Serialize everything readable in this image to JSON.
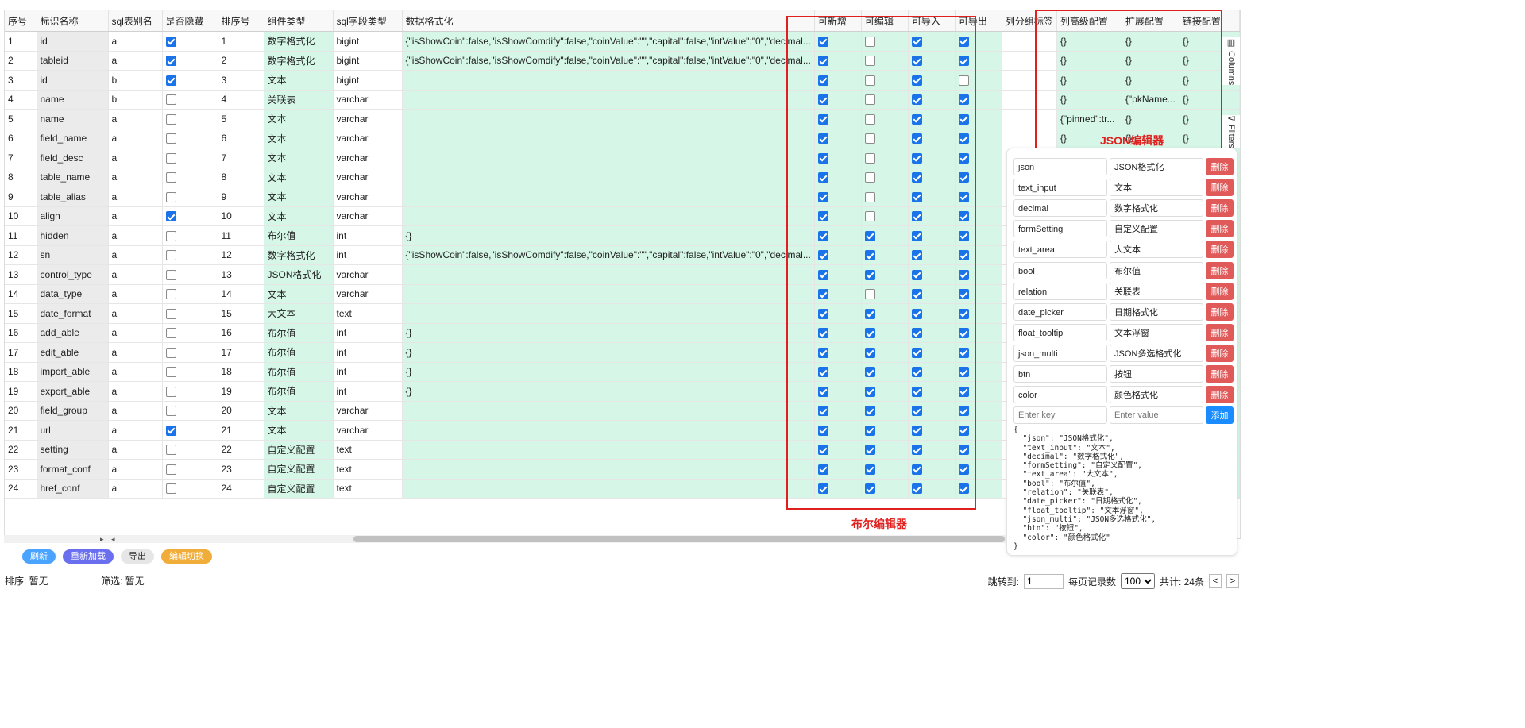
{
  "columns": [
    "序号",
    "标识名称",
    "sql表别名",
    "是否隐藏",
    "排序号",
    "组件类型",
    "sql字段类型",
    "数据格式化",
    "可新增",
    "可编辑",
    "可导入",
    "可导出",
    "列分组标签",
    "列高级配置",
    "扩展配置",
    "链接配置"
  ],
  "rows": [
    {
      "n": "1",
      "name": "id",
      "alias": "a",
      "hidden": true,
      "sort": "1",
      "ctype": "数字格式化",
      "sqltype": "bigint",
      "fmt": "{\"isShowCoin\":false,\"isShowComdify\":false,\"coinValue\":\"\",\"capital\":false,\"intValue\":\"0\",\"decimal...",
      "add": true,
      "edit": false,
      "imp": true,
      "exp": true,
      "adv": "{}",
      "ext": "{}",
      "link": "{}"
    },
    {
      "n": "2",
      "name": "tableid",
      "alias": "a",
      "hidden": true,
      "sort": "2",
      "ctype": "数字格式化",
      "sqltype": "bigint",
      "fmt": "{\"isShowCoin\":false,\"isShowComdify\":false,\"coinValue\":\"\",\"capital\":false,\"intValue\":\"0\",\"decimal...",
      "add": true,
      "edit": false,
      "imp": true,
      "exp": true,
      "adv": "{}",
      "ext": "{}",
      "link": "{}"
    },
    {
      "n": "3",
      "name": "id",
      "alias": "b",
      "hidden": true,
      "sort": "3",
      "ctype": "文本",
      "sqltype": "bigint",
      "fmt": "",
      "add": true,
      "edit": false,
      "imp": true,
      "exp": false,
      "adv": "{}",
      "ext": "{}",
      "link": "{}"
    },
    {
      "n": "4",
      "name": "name",
      "alias": "b",
      "hidden": false,
      "sort": "4",
      "ctype": "关联表",
      "sqltype": "varchar",
      "fmt": "",
      "add": true,
      "edit": false,
      "imp": true,
      "exp": true,
      "adv": "{}",
      "ext": "{\"pkName...",
      "link": "{}"
    },
    {
      "n": "5",
      "name": "name",
      "alias": "a",
      "hidden": false,
      "sort": "5",
      "ctype": "文本",
      "sqltype": "varchar",
      "fmt": "",
      "add": true,
      "edit": false,
      "imp": true,
      "exp": true,
      "adv": "{\"pinned\":tr...",
      "ext": "{}",
      "link": "{}"
    },
    {
      "n": "6",
      "name": "field_name",
      "alias": "a",
      "hidden": false,
      "sort": "6",
      "ctype": "文本",
      "sqltype": "varchar",
      "fmt": "",
      "add": true,
      "edit": false,
      "imp": true,
      "exp": true,
      "adv": "{}",
      "ext": "{}",
      "link": "{}"
    },
    {
      "n": "7",
      "name": "field_desc",
      "alias": "a",
      "hidden": false,
      "sort": "7",
      "ctype": "文本",
      "sqltype": "varchar",
      "fmt": "",
      "add": true,
      "edit": false,
      "imp": true,
      "exp": true,
      "adv": "",
      "ext": "",
      "link": ""
    },
    {
      "n": "8",
      "name": "table_name",
      "alias": "a",
      "hidden": false,
      "sort": "8",
      "ctype": "文本",
      "sqltype": "varchar",
      "fmt": "",
      "add": true,
      "edit": false,
      "imp": true,
      "exp": true,
      "adv": "",
      "ext": "",
      "link": ""
    },
    {
      "n": "9",
      "name": "table_alias",
      "alias": "a",
      "hidden": false,
      "sort": "9",
      "ctype": "文本",
      "sqltype": "varchar",
      "fmt": "",
      "add": true,
      "edit": false,
      "imp": true,
      "exp": true,
      "adv": "",
      "ext": "",
      "link": ""
    },
    {
      "n": "10",
      "name": "align",
      "alias": "a",
      "hidden": true,
      "sort": "10",
      "ctype": "文本",
      "sqltype": "varchar",
      "fmt": "",
      "add": true,
      "edit": false,
      "imp": true,
      "exp": true,
      "adv": "",
      "ext": "",
      "link": ""
    },
    {
      "n": "11",
      "name": "hidden",
      "alias": "a",
      "hidden": false,
      "sort": "11",
      "ctype": "布尔值",
      "sqltype": "int",
      "fmt": "{}",
      "add": true,
      "edit": true,
      "imp": true,
      "exp": true,
      "adv": "",
      "ext": "",
      "link": ""
    },
    {
      "n": "12",
      "name": "sn",
      "alias": "a",
      "hidden": false,
      "sort": "12",
      "ctype": "数字格式化",
      "sqltype": "int",
      "fmt": "{\"isShowCoin\":false,\"isShowComdify\":false,\"coinValue\":\"\",\"capital\":false,\"intValue\":\"0\",\"decimal...",
      "add": true,
      "edit": true,
      "imp": true,
      "exp": true,
      "adv": "",
      "ext": "",
      "link": ""
    },
    {
      "n": "13",
      "name": "control_type",
      "alias": "a",
      "hidden": false,
      "sort": "13",
      "ctype": "JSON格式化",
      "sqltype": "varchar",
      "fmt": "",
      "add": true,
      "edit": true,
      "imp": true,
      "exp": true,
      "adv": "",
      "ext": "",
      "link": ""
    },
    {
      "n": "14",
      "name": "data_type",
      "alias": "a",
      "hidden": false,
      "sort": "14",
      "ctype": "文本",
      "sqltype": "varchar",
      "fmt": "",
      "add": true,
      "edit": false,
      "imp": true,
      "exp": true,
      "adv": "",
      "ext": "",
      "link": ""
    },
    {
      "n": "15",
      "name": "date_format",
      "alias": "a",
      "hidden": false,
      "sort": "15",
      "ctype": "大文本",
      "sqltype": "text",
      "fmt": "",
      "add": true,
      "edit": true,
      "imp": true,
      "exp": true,
      "adv": "",
      "ext": "",
      "link": ""
    },
    {
      "n": "16",
      "name": "add_able",
      "alias": "a",
      "hidden": false,
      "sort": "16",
      "ctype": "布尔值",
      "sqltype": "int",
      "fmt": "{}",
      "add": true,
      "edit": true,
      "imp": true,
      "exp": true,
      "adv": "",
      "ext": "",
      "link": ""
    },
    {
      "n": "17",
      "name": "edit_able",
      "alias": "a",
      "hidden": false,
      "sort": "17",
      "ctype": "布尔值",
      "sqltype": "int",
      "fmt": "{}",
      "add": true,
      "edit": true,
      "imp": true,
      "exp": true,
      "adv": "",
      "ext": "",
      "link": ""
    },
    {
      "n": "18",
      "name": "import_able",
      "alias": "a",
      "hidden": false,
      "sort": "18",
      "ctype": "布尔值",
      "sqltype": "int",
      "fmt": "{}",
      "add": true,
      "edit": true,
      "imp": true,
      "exp": true,
      "adv": "",
      "ext": "",
      "link": ""
    },
    {
      "n": "19",
      "name": "export_able",
      "alias": "a",
      "hidden": false,
      "sort": "19",
      "ctype": "布尔值",
      "sqltype": "int",
      "fmt": "{}",
      "add": true,
      "edit": true,
      "imp": true,
      "exp": true,
      "adv": "",
      "ext": "",
      "link": ""
    },
    {
      "n": "20",
      "name": "field_group",
      "alias": "a",
      "hidden": false,
      "sort": "20",
      "ctype": "文本",
      "sqltype": "varchar",
      "fmt": "",
      "add": true,
      "edit": true,
      "imp": true,
      "exp": true,
      "adv": "",
      "ext": "",
      "link": ""
    },
    {
      "n": "21",
      "name": "url",
      "alias": "a",
      "hidden": true,
      "sort": "21",
      "ctype": "文本",
      "sqltype": "varchar",
      "fmt": "",
      "add": true,
      "edit": true,
      "imp": true,
      "exp": true,
      "adv": "",
      "ext": "",
      "link": ""
    },
    {
      "n": "22",
      "name": "setting",
      "alias": "a",
      "hidden": false,
      "sort": "22",
      "ctype": "自定义配置",
      "sqltype": "text",
      "fmt": "",
      "add": true,
      "edit": true,
      "imp": true,
      "exp": true,
      "adv": "",
      "ext": "",
      "link": ""
    },
    {
      "n": "23",
      "name": "format_conf",
      "alias": "a",
      "hidden": false,
      "sort": "23",
      "ctype": "自定义配置",
      "sqltype": "text",
      "fmt": "",
      "add": true,
      "edit": true,
      "imp": true,
      "exp": true,
      "adv": "",
      "ext": "",
      "link": ""
    },
    {
      "n": "24",
      "name": "href_conf",
      "alias": "a",
      "hidden": false,
      "sort": "24",
      "ctype": "自定义配置",
      "sqltype": "text",
      "fmt": "",
      "add": true,
      "edit": true,
      "imp": true,
      "exp": true,
      "adv": "",
      "ext": "",
      "link": ""
    }
  ],
  "side": {
    "columns_label": "Columns",
    "filters_label": "Filters"
  },
  "annotations": {
    "bool_editor": "布尔编辑器",
    "json_editor": "JSON编辑器"
  },
  "buttons": {
    "refresh": "刷新",
    "reload": "重新加载",
    "export": "导出",
    "toggle": "编辑切换"
  },
  "status": {
    "sort": "排序: 暂无",
    "filter": "筛选: 暂无",
    "jump_label": "跳转到:",
    "jump_value": "1",
    "page_size_label": "每页记录数",
    "page_size": "100",
    "total": "共计: 24条",
    "prev": "<",
    "next": ">"
  },
  "panel": {
    "items": [
      {
        "key": "json",
        "value": "JSON格式化"
      },
      {
        "key": "text_input",
        "value": "文本"
      },
      {
        "key": "decimal",
        "value": "数字格式化"
      },
      {
        "key": "formSetting",
        "value": "自定义配置"
      },
      {
        "key": "text_area",
        "value": "大文本"
      },
      {
        "key": "bool",
        "value": "布尔值"
      },
      {
        "key": "relation",
        "value": "关联表"
      },
      {
        "key": "date_picker",
        "value": "日期格式化"
      },
      {
        "key": "float_tooltip",
        "value": "文本浮窗"
      },
      {
        "key": "json_multi",
        "value": "JSON多选格式化"
      },
      {
        "key": "btn",
        "value": "按钮"
      },
      {
        "key": "color",
        "value": "颜色格式化"
      }
    ],
    "delete_label": "删除",
    "key_placeholder": "Enter key",
    "value_placeholder": "Enter value",
    "add_label": "添加",
    "json_text": "{\n  \"json\": \"JSON格式化\",\n  \"text_input\": \"文本\",\n  \"decimal\": \"数字格式化\",\n  \"formSetting\": \"自定义配置\",\n  \"text_area\": \"大文本\",\n  \"bool\": \"布尔值\",\n  \"relation\": \"关联表\",\n  \"date_picker\": \"日期格式化\",\n  \"float_tooltip\": \"文本浮窗\",\n  \"json_multi\": \"JSON多选格式化\",\n  \"btn\": \"按钮\",\n  \"color\": \"颜色格式化\"\n}"
  },
  "colors": {
    "green_cell": "#d6f7e8",
    "annotation_red": "#e0201e",
    "checkbox_blue": "#1a73e8",
    "delete_red": "#e05a5a",
    "add_blue": "#1a8cff"
  }
}
